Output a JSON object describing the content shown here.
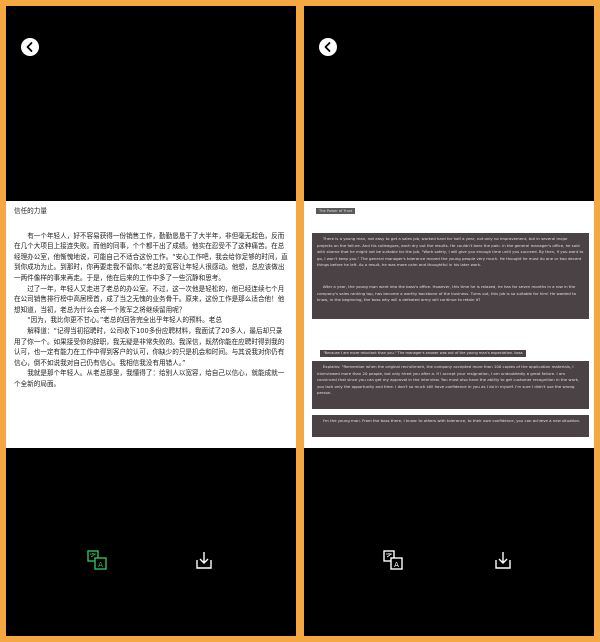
{
  "left": {
    "title": "信任的力量",
    "paragraphs": [
      "有一个年轻人，好不容易获得一份销售工作，勤勤恳恳干了大半年，非但毫无起色，反而在几个大项目上接连失败。而他的同事，个个都干出了成绩。他实在忍受不了这种痛苦。在总经理办公室，他惭愧地说，可能自己不适合这份工作。“安心工作吧，我会给你足够的时间，直到你成功为止。到那时，你再要走我不留你。”老总的宽容让年轻人很感动。他想，总应该做出一两件像样的事来再走。于是，他在后来的工作中多了一些沉静和思考。",
      "过了一年，年轻人又走进了老总的办公室。不过，这一次他是轻松的，他已经连续七个月在公司销售排行榜中高居榜首，成了当之无愧的业务骨干。原来，这份工作是那么适合他！他想知道，当初，老总为什么会将一个败军之将继续留用呢？",
      "“因为，我比你更不甘心。”老总的回答完全出乎年轻人的预料。老总",
      "解释道：“记得当初招聘时，公司收下100多份应聘材料，我面试了20多人，最后却只录用了你一个。如果接受你的辞职，我无疑是非常失败的。我深信，既然你能在应聘时得到我的认可，也一定有能力在工作中得到客户的认可，你缺少的只是机会和时间。与其说我对你仍有信心，倒不如说我对自己仍有信心。我相信我没有用错人。”",
      "我就是那个年轻人。从老总那里，我懂得了：给别人以宽容，给自己以信心，就能成就一个全新的局面。"
    ]
  },
  "right": {
    "tag": "The Power of Trust",
    "block1": "There is a young man, not easy to get a sales job, worked hard for half a year, not only no improvement, but in several major projects on the failure. And his colleagues, each dry out the results. He couldn't bear the pain. In the general manager's office, he said with shame that he might not be suitable for the job. \"Work safely, I will give you enough time until you succeed. By then, if you want to go, I won't keep you.\" The general manager's tolerance moved the young people very much. He thought he must do one or two decent things before he left. As a result, he was more calm and thoughtful in his later work.",
    "block2": "After a year, the young man went into the boss's office. However, this time he is relaxed, he has for seven months in a row in the company's sales ranking top, has become a worthy backbone of the business. Turns out, this job is so suitable for him! He wanted to know, in the beginning, the boss why will a defeated army will continue to retain it?",
    "caption": "\"Because I am more reluctant than you.\" The manager's answer was out of the young man's expectation. boss",
    "block3": "Explains: \"Remember when the original recruitment, the company accepted more than 100 copies of the application materials, I interviewed more than 20 people, but only hired you after a. If I accept your resignation, I am undoubtedly a great failure. I am convinced that since you can get my approval in the interview. You must also have the ability to get customer recognition in the work, you lack only the opportunity and time. I don't so much still have confidence in you as I do in myself. I'm sure I didn't use the wrong person.",
    "block4": "I'm the young man. From the boss there, I know: to others with tolerance, to their own confidence, you can achieve a new situation."
  },
  "icons": {
    "accent": "#2fbf5f",
    "translate": "translate-icon",
    "download": "download-icon",
    "back": "back-arrow-icon"
  }
}
